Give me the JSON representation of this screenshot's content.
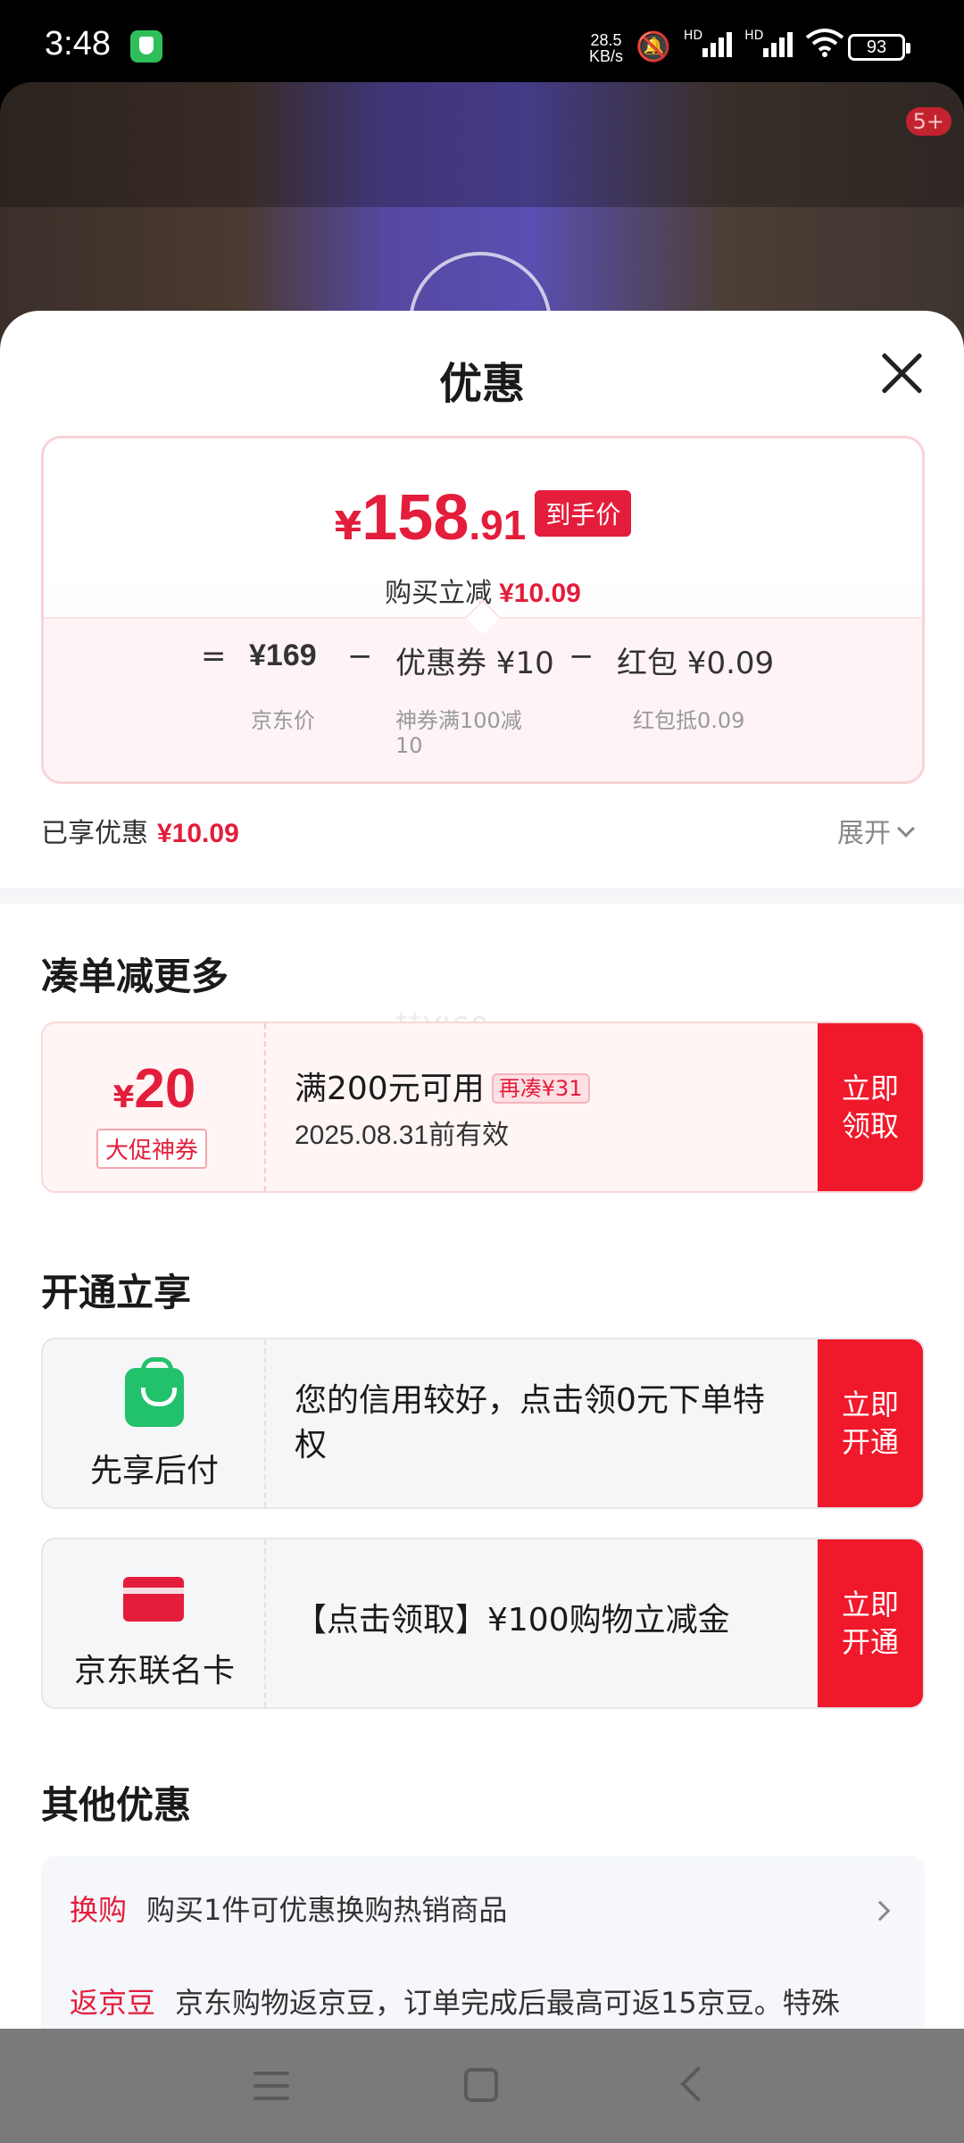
{
  "status_bar": {
    "time": "3:48",
    "net_speed_value": "28.5",
    "net_speed_unit": "KB/s",
    "hd1": "HD",
    "hd2": "HD",
    "battery": "93"
  },
  "background": {
    "notification_badge": "5+"
  },
  "sheet": {
    "title": "优惠",
    "price": {
      "currency": "¥",
      "integer": "158",
      "decimal": ".91",
      "tag": "到手价",
      "save_label": "购买立减",
      "save_amount": "¥10.09"
    },
    "formula": {
      "equals": "=",
      "jd_price": "¥169",
      "minus1": "−",
      "coupon": "优惠券 ¥10",
      "minus2": "−",
      "redpacket": "红包 ¥0.09",
      "jd_price_label": "京东价",
      "coupon_label_line1": "神券满100减",
      "coupon_label_line2": "10",
      "redpacket_label": "红包抵0.09"
    },
    "enjoyed_label": "已享优惠",
    "enjoyed_amount": "¥10.09",
    "expand_label": "展开"
  },
  "watermark": "赫YJ60",
  "sections": {
    "more": {
      "title": "凑单减更多",
      "coupon": {
        "currency": "¥",
        "amount": "20",
        "tag": "大促神券",
        "condition": "满200元可用",
        "pill": "再凑¥31",
        "expiry": "2025.08.31前有效",
        "button": "立即\n领取"
      }
    },
    "open": {
      "title": "开通立享",
      "items": [
        {
          "icon": "shopping-bag-icon",
          "label": "先享后付",
          "text": "您的信用较好，点击领0元下单特权",
          "button": "立即\n开通"
        },
        {
          "icon": "credit-card-icon",
          "label": "京东联名卡",
          "text": "【点击领取】¥100购物立减金",
          "button": "立即\n开通"
        }
      ]
    },
    "other": {
      "title": "其他优惠",
      "rows": [
        {
          "tag": "换购",
          "text": "购买1件可优惠换购热销商品"
        },
        {
          "tag": "返京豆",
          "text": "京东购物返京豆，订单完成后最高可返15京豆。特殊"
        }
      ]
    }
  },
  "colors": {
    "accent_red": "#e31d3b",
    "button_red": "#f0182b",
    "green_icon": "#22c16b"
  }
}
